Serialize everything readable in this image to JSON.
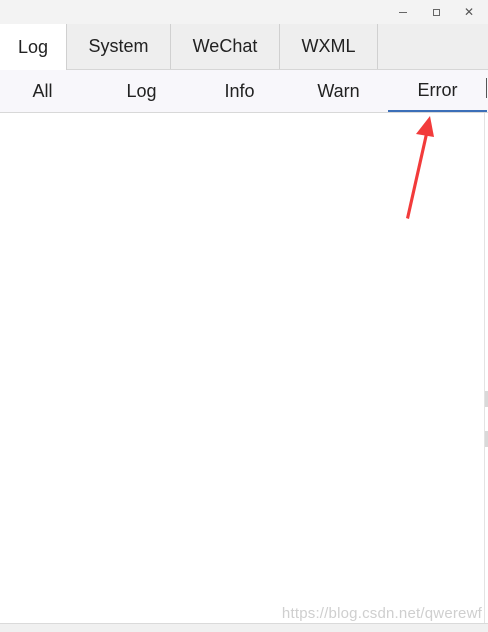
{
  "window": {
    "minimize_icon": "minimize-icon",
    "maximize_icon": "maximize-icon",
    "close_icon": "close-icon",
    "close_glyph": "✕"
  },
  "top_tabs": [
    {
      "label": "Log",
      "active": true
    },
    {
      "label": "System",
      "active": false
    },
    {
      "label": "WeChat",
      "active": false
    },
    {
      "label": "WXML",
      "active": false
    }
  ],
  "sub_tabs": [
    {
      "label": "All",
      "active": false
    },
    {
      "label": "Log",
      "active": false
    },
    {
      "label": "Info",
      "active": false
    },
    {
      "label": "Warn",
      "active": false
    },
    {
      "label": "Error",
      "active": true
    }
  ],
  "watermark": "https://blog.csdn.net/qwerewf",
  "colors": {
    "active_underline": "#3c6fb8",
    "annotation_arrow": "#f23b3b",
    "tab_bar_bg": "#eeeeee",
    "subtab_bar_bg": "#f8f7fb"
  }
}
